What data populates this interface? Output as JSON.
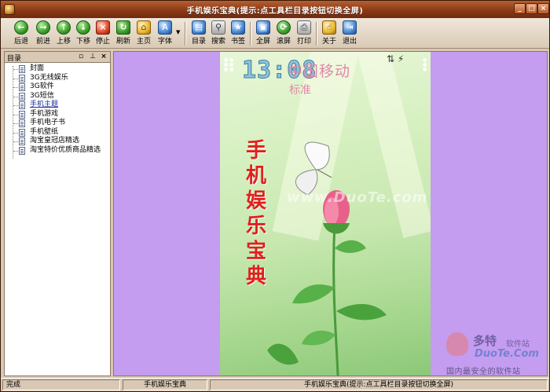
{
  "window": {
    "title": "手机娱乐宝典(提示:点工具栏目录按钮切换全屏)",
    "controls": [
      "_",
      "□",
      "×"
    ]
  },
  "toolbar": {
    "buttons": [
      {
        "label": "后退",
        "icon": "arrow-left-icon"
      },
      {
        "label": "前进",
        "icon": "arrow-right-icon"
      },
      {
        "label": "上移",
        "icon": "arrow-up-icon"
      },
      {
        "label": "下移",
        "icon": "arrow-down-icon"
      },
      {
        "label": "停止",
        "icon": "stop-icon"
      },
      {
        "label": "刷新",
        "icon": "refresh-icon"
      },
      {
        "label": "主页",
        "icon": "home-icon"
      },
      {
        "label": "字体",
        "icon": "font-icon"
      },
      {
        "label": "目录",
        "icon": "contents-icon"
      },
      {
        "label": "搜索",
        "icon": "search-icon"
      },
      {
        "label": "书签",
        "icon": "bookmark-icon"
      },
      {
        "label": "全屏",
        "icon": "fullscreen-icon"
      },
      {
        "label": "滚屏",
        "icon": "scroll-icon"
      },
      {
        "label": "打印",
        "icon": "print-icon"
      },
      {
        "label": "关于",
        "icon": "about-icon"
      },
      {
        "label": "退出",
        "icon": "exit-icon"
      }
    ]
  },
  "sidebar": {
    "title": "目录",
    "items": [
      {
        "label": "封面"
      },
      {
        "label": "3G无线娱乐"
      },
      {
        "label": "3G软件"
      },
      {
        "label": "3G短信"
      },
      {
        "label": "手机主题",
        "selected": true
      },
      {
        "label": "手机游戏"
      },
      {
        "label": "手机电子书"
      },
      {
        "label": "手机壁纸"
      },
      {
        "label": "淘宝皇冠店精选"
      },
      {
        "label": "淘宝特价优质商品精选"
      }
    ]
  },
  "phone": {
    "time": "13:08",
    "carrier": "中国移动",
    "mode": "标准",
    "title": "手机娱乐宝典",
    "watermark": "www.DuoTe.com"
  },
  "statusbar": {
    "status": "完成",
    "name": "手机娱乐宝典",
    "hint": "手机娱乐宝典(提示:点工具栏目录按钮切换全屏)"
  },
  "site_watermark": {
    "line1": "多特",
    "line1_small": "软件站",
    "line2": "DuoTe.Com",
    "line3": "国内最安全的软件站"
  },
  "colors": {
    "titlebar": "#8a3a16",
    "content_bg": "#c49cf0",
    "phone_title": "#e0201c"
  }
}
